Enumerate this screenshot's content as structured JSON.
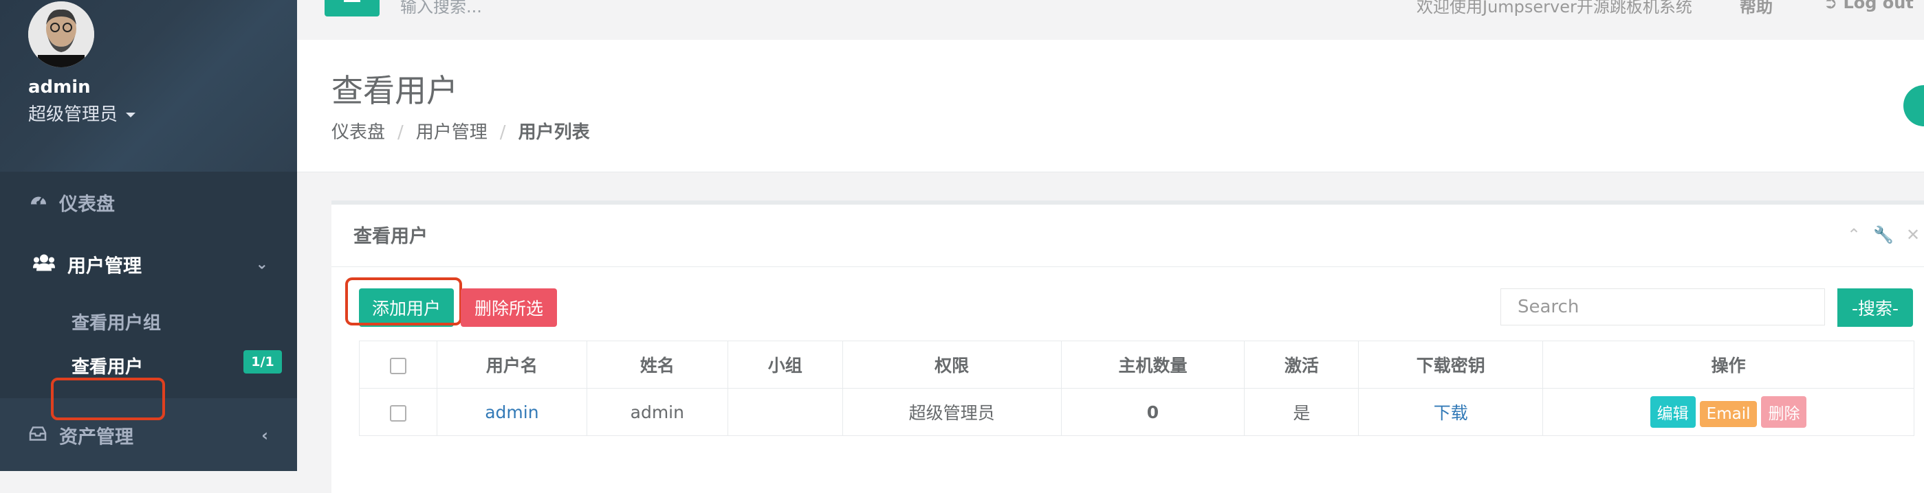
{
  "profile": {
    "name": "admin",
    "role": "超级管理员"
  },
  "sidebar": {
    "dashboard": "仪表盘",
    "user_mgmt": "用户管理",
    "sub_items": [
      "查看用户组",
      "查看用户"
    ],
    "count_badge": "1/1",
    "asset_mgmt": "资产管理"
  },
  "topbar": {
    "search_placeholder": "输入搜索...",
    "welcome": "欢迎使用Jumpserver开源跳板机系统",
    "help": "帮助",
    "logout": "Log out"
  },
  "heading": {
    "title": "查看用户",
    "breadcrumb": [
      "仪表盘",
      "用户管理",
      "用户列表"
    ]
  },
  "ibox": {
    "title": "查看用户",
    "add_button": "添加用户",
    "delete_button": "删除所选",
    "search_placeholder": "Search",
    "search_button": "-搜索-"
  },
  "table": {
    "headers": [
      "",
      "用户名",
      "姓名",
      "小组",
      "权限",
      "主机数量",
      "激活",
      "下载密钥",
      "操作"
    ],
    "rows": [
      {
        "username": "admin",
        "name": "admin",
        "group": "",
        "role": "超级管理员",
        "hosts": "0",
        "active": "是",
        "download": "下载",
        "actions": [
          "编辑",
          "Email",
          "删除"
        ]
      }
    ]
  },
  "colors": {
    "accent": "#1ab394",
    "danger": "#ed5565",
    "info": "#23c6c8",
    "warning": "#f8ac59",
    "sidebar": "#2f4050",
    "highlight": "#e0401f"
  }
}
